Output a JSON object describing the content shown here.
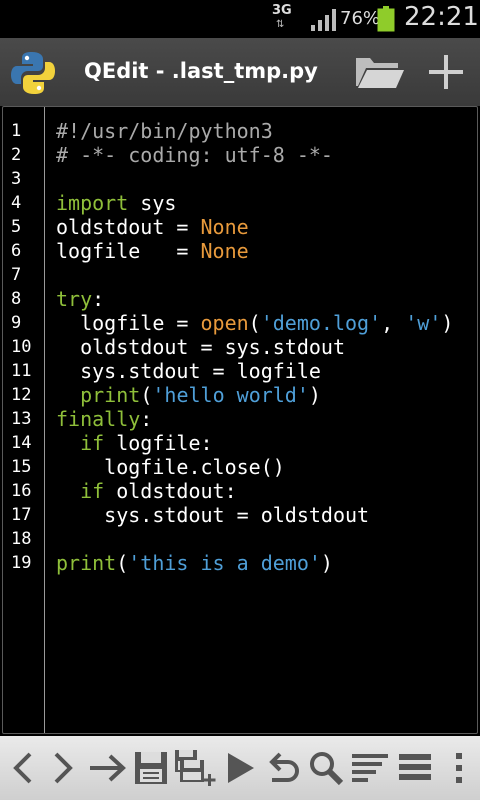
{
  "status": {
    "network": "3G",
    "battery_pct": "76%",
    "time": "22:21"
  },
  "actionbar": {
    "title": "QEdit - .last_tmp.py",
    "app_icon": "python-logo-icon",
    "open_icon": "folder-icon",
    "new_icon": "plus-icon"
  },
  "editor": {
    "lines": [
      {
        "n": "1",
        "tokens": [
          {
            "t": "#!/usr/bin/python3",
            "c": "cm"
          }
        ]
      },
      {
        "n": "2",
        "tokens": [
          {
            "t": "# -*- coding: utf-8 -*-",
            "c": "cm"
          }
        ]
      },
      {
        "n": "3",
        "tokens": []
      },
      {
        "n": "4",
        "tokens": [
          {
            "t": "import",
            "c": "kw"
          },
          {
            "t": " sys",
            "c": ""
          }
        ]
      },
      {
        "n": "5",
        "tokens": [
          {
            "t": "oldstdout = ",
            "c": ""
          },
          {
            "t": "None",
            "c": "cn"
          }
        ]
      },
      {
        "n": "6",
        "tokens": [
          {
            "t": "logfile   = ",
            "c": ""
          },
          {
            "t": "None",
            "c": "cn"
          }
        ]
      },
      {
        "n": "7",
        "tokens": []
      },
      {
        "n": "8",
        "tokens": [
          {
            "t": "try",
            "c": "kw"
          },
          {
            "t": ":",
            "c": ""
          }
        ]
      },
      {
        "n": "9",
        "tokens": [
          {
            "t": "  logfile = ",
            "c": ""
          },
          {
            "t": "open",
            "c": "cn"
          },
          {
            "t": "(",
            "c": ""
          },
          {
            "t": "'demo.log'",
            "c": "st"
          },
          {
            "t": ", ",
            "c": ""
          },
          {
            "t": "'w'",
            "c": "st"
          },
          {
            "t": ")",
            "c": ""
          }
        ]
      },
      {
        "n": "10",
        "tokens": [
          {
            "t": "  oldstdout = sys.stdout",
            "c": ""
          }
        ]
      },
      {
        "n": "11",
        "tokens": [
          {
            "t": "  sys.stdout = logfile",
            "c": ""
          }
        ]
      },
      {
        "n": "12",
        "tokens": [
          {
            "t": "  ",
            "c": ""
          },
          {
            "t": "print",
            "c": "kw"
          },
          {
            "t": "(",
            "c": ""
          },
          {
            "t": "'hello world'",
            "c": "st"
          },
          {
            "t": ")",
            "c": ""
          }
        ]
      },
      {
        "n": "13",
        "tokens": [
          {
            "t": "finally",
            "c": "kw"
          },
          {
            "t": ":",
            "c": ""
          }
        ]
      },
      {
        "n": "14",
        "tokens": [
          {
            "t": "  ",
            "c": ""
          },
          {
            "t": "if",
            "c": "kw"
          },
          {
            "t": " logfile:",
            "c": ""
          }
        ]
      },
      {
        "n": "15",
        "tokens": [
          {
            "t": "    logfile.close()",
            "c": ""
          }
        ]
      },
      {
        "n": "16",
        "tokens": [
          {
            "t": "  ",
            "c": ""
          },
          {
            "t": "if",
            "c": "kw"
          },
          {
            "t": " oldstdout:",
            "c": ""
          }
        ]
      },
      {
        "n": "17",
        "tokens": [
          {
            "t": "    sys.stdout = oldstdout",
            "c": ""
          }
        ]
      },
      {
        "n": "18",
        "tokens": []
      },
      {
        "n": "19",
        "tokens": [
          {
            "t": "print",
            "c": "kw"
          },
          {
            "t": "(",
            "c": ""
          },
          {
            "t": "'this is a demo'",
            "c": "st"
          },
          {
            "t": ")",
            "c": ""
          }
        ]
      }
    ]
  },
  "toolbar": {
    "buttons": [
      "back-icon",
      "forward-icon",
      "goto-line-icon",
      "save-icon",
      "save-as-icon",
      "run-icon",
      "undo-icon",
      "search-icon",
      "format-icon",
      "menu-list-icon",
      "overflow-menu-icon"
    ]
  },
  "colors": {
    "keyword": "#8fbf3a",
    "constant": "#e89a3c",
    "string": "#4f9fd8",
    "actionbar": "#424242",
    "toolbar": "#dcdcdc"
  }
}
